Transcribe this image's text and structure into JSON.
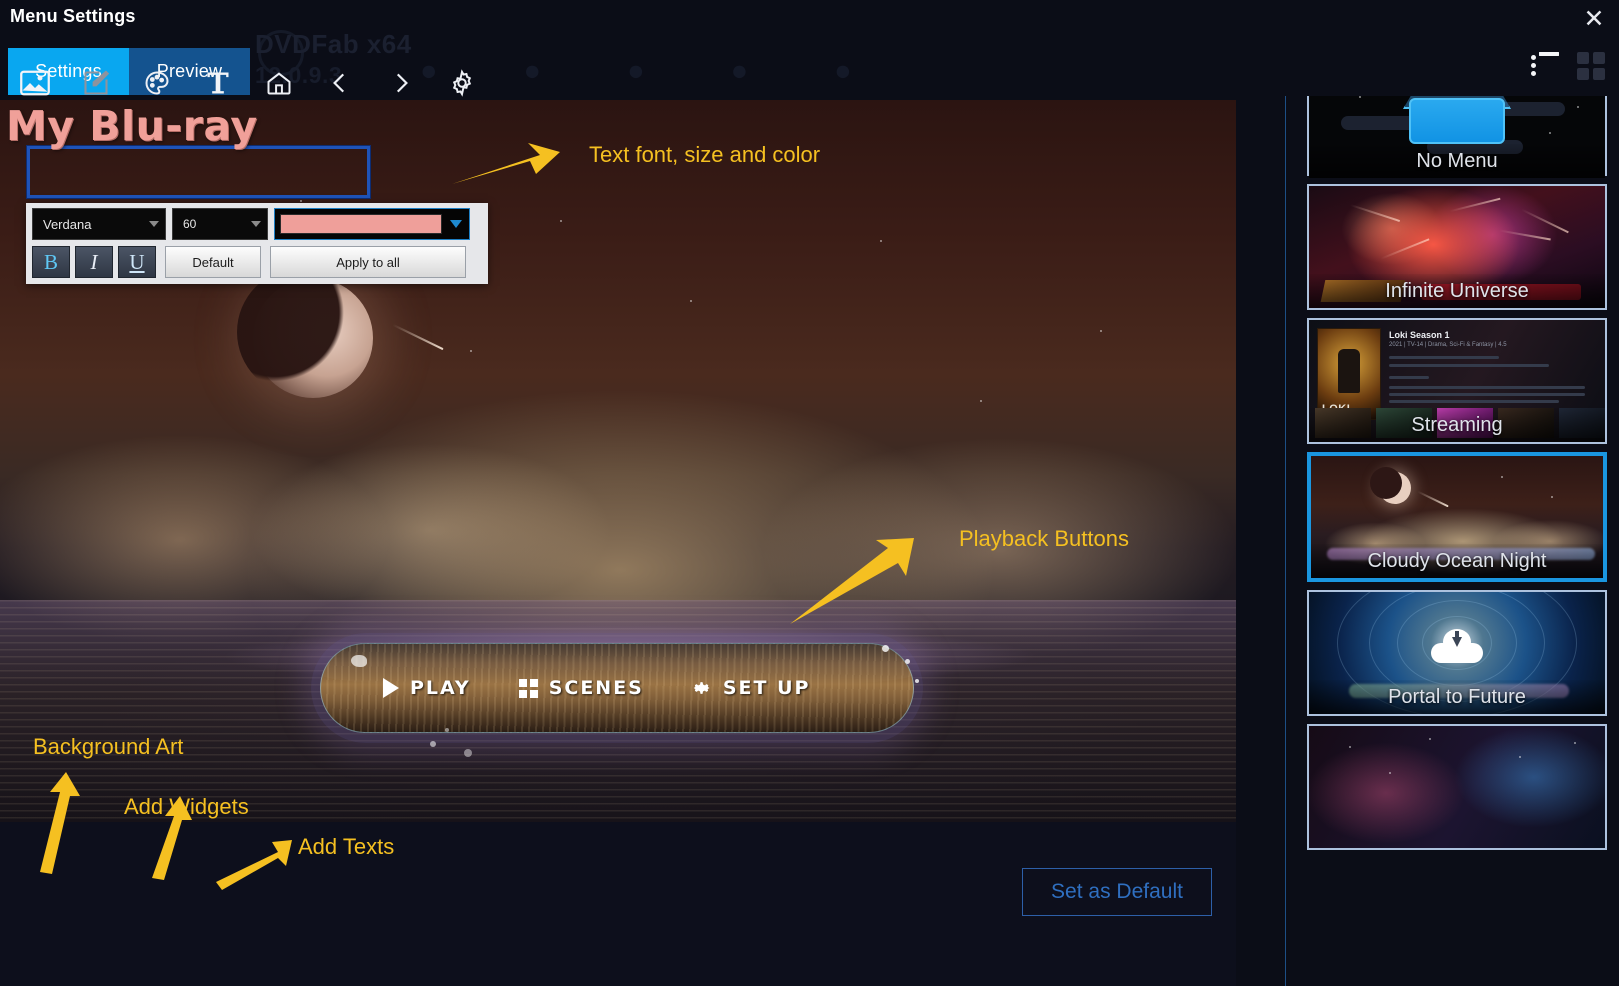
{
  "window": {
    "title": "Menu Settings",
    "close_label": "✕",
    "watermark_name": "DVDFab x64",
    "watermark_version": "12.0.9.3"
  },
  "tabs": [
    {
      "label": "Settings",
      "active": true
    },
    {
      "label": "Preview",
      "active": false
    }
  ],
  "view_toggles": [
    {
      "name": "list-view-icon",
      "active": true
    },
    {
      "name": "grid-view-icon",
      "active": false
    }
  ],
  "canvas": {
    "title_text": "My Blu-ray",
    "text_format": {
      "font_family_value": "Verdana",
      "font_size_value": "60",
      "color_value": "#ef9f9a",
      "bold_label": "B",
      "italic_label": "I",
      "underline_label": "U",
      "default_label": "Default",
      "apply_all_label": "Apply to all"
    },
    "playback_buttons": [
      {
        "label": "PLAY",
        "icon": "play-triangle-icon"
      },
      {
        "label": "SCENES",
        "icon": "grid-squares-icon"
      },
      {
        "label": "SET UP",
        "icon": "gear-icon"
      }
    ]
  },
  "annotations": [
    {
      "text": "Text font, size and color",
      "color": "#f5c021"
    },
    {
      "text": "Playback Buttons",
      "color": "#f5c021"
    },
    {
      "text": "Background Art",
      "color": "#f5c021"
    },
    {
      "text": "Add Widgets",
      "color": "#f5c021"
    },
    {
      "text": "Add Texts",
      "color": "#f5c021"
    }
  ],
  "toolbar": {
    "tools": [
      {
        "name": "background-image-icon",
        "label": "Background Art"
      },
      {
        "name": "edit-pencil-icon",
        "label": "Edit"
      },
      {
        "name": "palette-icon",
        "label": "Add Widgets"
      },
      {
        "name": "text-icon",
        "label": "Add Texts"
      },
      {
        "name": "home-icon",
        "label": "Home"
      },
      {
        "name": "chevron-left-icon",
        "label": "Previous"
      },
      {
        "name": "chevron-right-icon",
        "label": "Next"
      },
      {
        "name": "gear-icon",
        "label": "Settings"
      }
    ],
    "set_as_default_label": "Set as Default"
  },
  "sidebar": {
    "templates": [
      {
        "label": "No Menu",
        "selected": false,
        "art": "nomenu"
      },
      {
        "label": "Infinite Universe",
        "selected": false,
        "art": "universe"
      },
      {
        "label": "Streaming",
        "selected": false,
        "art": "stream",
        "stream": {
          "title": "Loki Season 1",
          "subtitle": "2021 | TV-14 | Drama, Sci-Fi & Fantasy | 4.5",
          "poster_text": "LOKI"
        }
      },
      {
        "label": "Cloudy Ocean Night",
        "selected": true,
        "art": "cloudy"
      },
      {
        "label": "Portal to Future",
        "selected": false,
        "art": "portal"
      },
      {
        "label": "",
        "selected": false,
        "art": "galaxy"
      }
    ]
  },
  "colors": {
    "accent_blue": "#09a7f0",
    "tab_inactive_blue": "#14538f",
    "selected_border": "#1a96e0",
    "thumb_border": "#adc2de",
    "annotation": "#f5c021",
    "title_text_color": "#f0a099"
  }
}
